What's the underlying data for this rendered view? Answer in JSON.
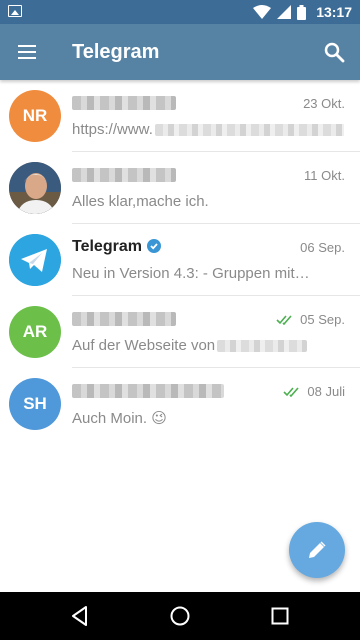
{
  "status_bar": {
    "time": "13:17"
  },
  "toolbar": {
    "title": "Telegram"
  },
  "chats": [
    {
      "avatar_initials": "NR",
      "avatar_color": "#f08c3e",
      "name": "",
      "date": "23 Okt.",
      "message": "https://www.",
      "read": false
    },
    {
      "avatar_initials": "",
      "avatar_color": "#7a6a55",
      "name": "",
      "date": "11 Okt.",
      "message": "Alles klar,mache ich.",
      "read": false
    },
    {
      "avatar_initials": "",
      "avatar_color": "#2ca5e0",
      "name": "Telegram",
      "verified": true,
      "date": "06 Sep.",
      "message": "Neu in Version 4.3:  - Gruppen mit…",
      "read": false
    },
    {
      "avatar_initials": "AR",
      "avatar_color": "#6cc04a",
      "name": "",
      "date": "05 Sep.",
      "message": "Auf der Webseite von",
      "read": true
    },
    {
      "avatar_initials": "SH",
      "avatar_color": "#4f98d9",
      "name": "",
      "date": "08 Juli",
      "message": "Auch Moin.",
      "emoji": "😉",
      "read": true
    }
  ],
  "colors": {
    "status_bar": "#3d6d97",
    "toolbar": "#5682a3",
    "fab": "#65a9e0",
    "read_check": "#4caf50"
  },
  "icons": {
    "menu": "menu-icon",
    "search": "search-icon",
    "compose": "pencil-icon",
    "back": "back-icon",
    "home": "home-icon",
    "recents": "recents-icon"
  }
}
